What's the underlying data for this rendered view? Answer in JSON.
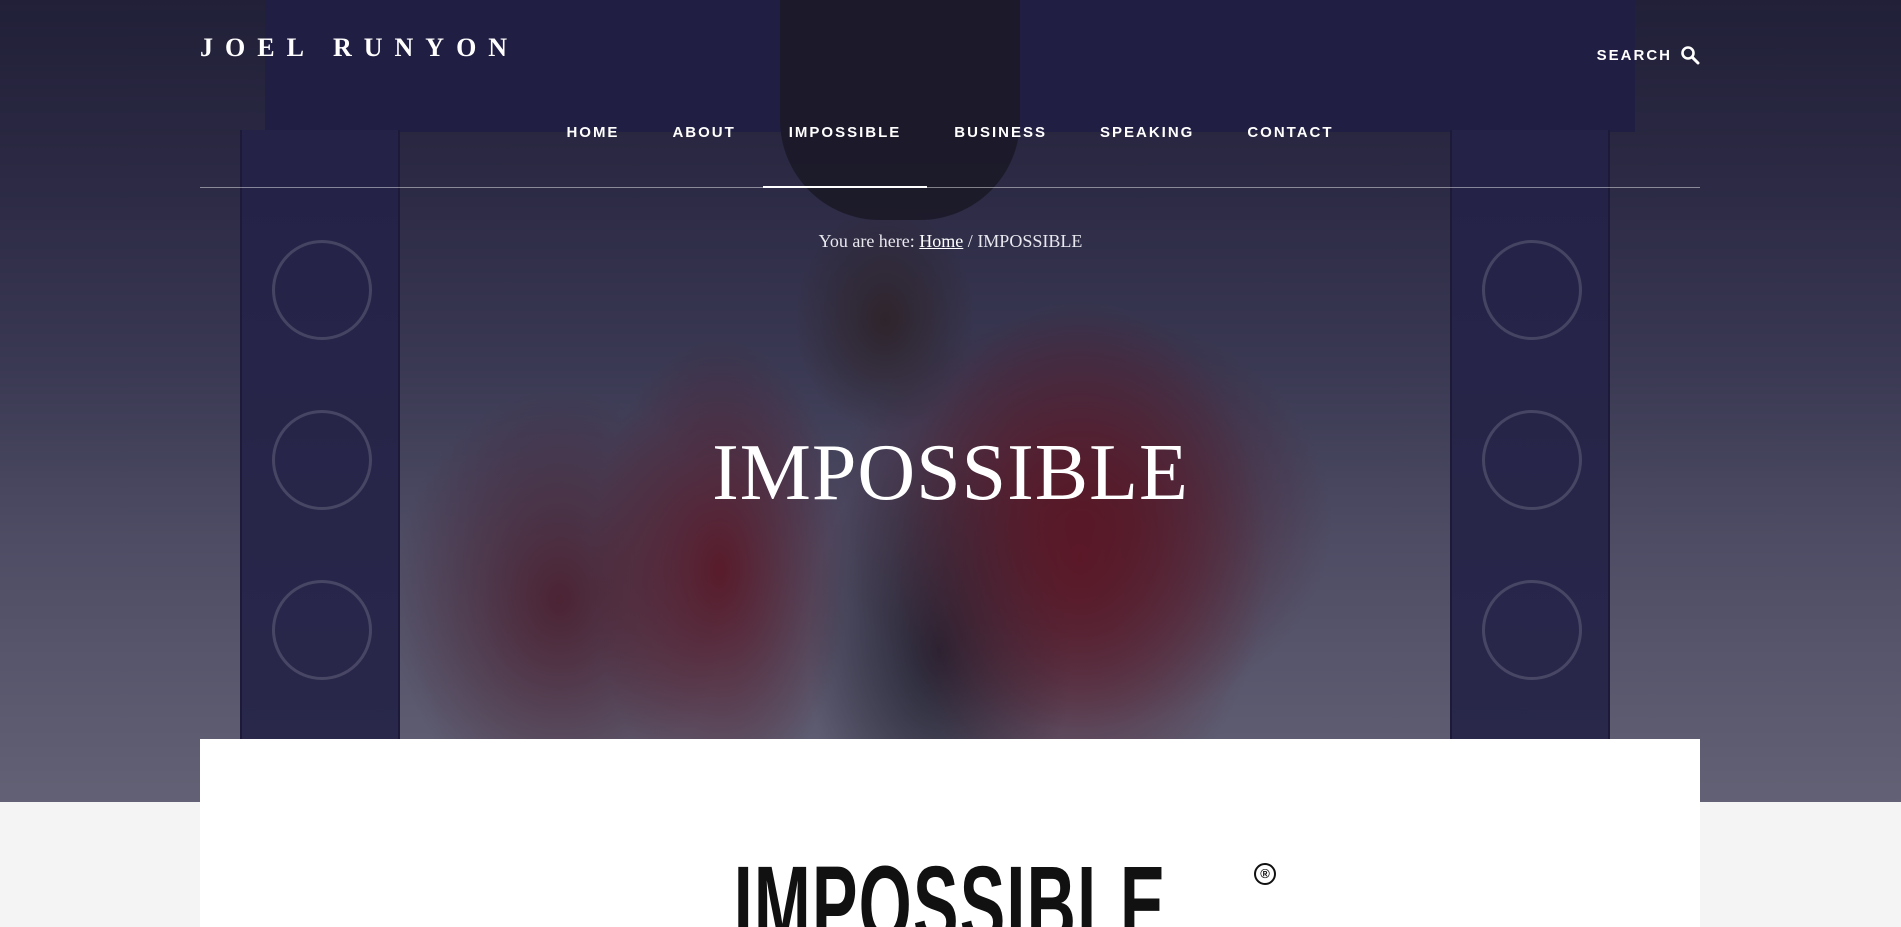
{
  "site": {
    "title": "JOEL RUNYON"
  },
  "header": {
    "search_label": "SEARCH",
    "search_icon": "magnifier-icon"
  },
  "nav": {
    "items": [
      {
        "label": "HOME"
      },
      {
        "label": "ABOUT"
      },
      {
        "label": "IMPOSSIBLE"
      },
      {
        "label": "BUSINESS"
      },
      {
        "label": "SPEAKING"
      },
      {
        "label": "CONTACT"
      }
    ],
    "active": "IMPOSSIBLE"
  },
  "breadcrumb": {
    "prefix": "You are here:",
    "home": "Home",
    "separator": "/",
    "current": "IMPOSSIBLE"
  },
  "page": {
    "title": "IMPOSSIBLE"
  },
  "content": {
    "logo_text": "IMPOSSIBLE",
    "logo_mark": "®"
  },
  "colors": {
    "overlay": "#1c1a30",
    "accent": "#ffffff",
    "page_bg": "#f4f4f4"
  }
}
